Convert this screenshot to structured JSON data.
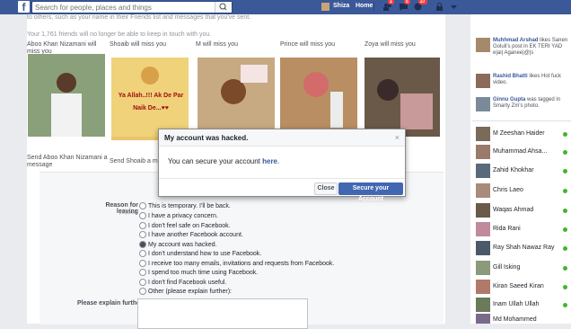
{
  "topbar": {
    "search_placeholder": "Search for people, places and things",
    "user_name": "Shiza",
    "home_label": "Home",
    "badges": {
      "friends": "1",
      "messages": "5",
      "notifications": "27"
    }
  },
  "header_text": "to others, such as your name in their Friends list and messages that you've sent.",
  "friends_note": "Your 1,761 friends will no longer be able to keep in touch with you.",
  "friends": [
    {
      "caption": "Aboo Khan Nizamani will miss you",
      "send": "Send Aboo Khan Nizamani a message",
      "img_color": "#6b7a5a"
    },
    {
      "caption": "Shoaib will miss you",
      "send": "Send Shoaib a message",
      "img_color": "#e0a94a",
      "overlay_text": "Ya Allah..!!!  Ak De Par Naik De...♥♥"
    },
    {
      "caption": "M will miss you",
      "send": "",
      "img_color": "#b88a5a"
    },
    {
      "caption": "Prince will miss you",
      "send": "",
      "img_color": "#c99a6a"
    },
    {
      "caption": "Zoya will miss you",
      "send": "",
      "img_color": "#5a4a3a"
    }
  ],
  "form": {
    "reason_label": "Reason for leaving",
    "required_label": "(required)",
    "options": [
      "This is temporary. I'll be back.",
      "I have a privacy concern.",
      "I don't feel safe on Facebook.",
      "I have another Facebook account.",
      "My account was hacked.",
      "I don't understand how to use Facebook.",
      "I receive too many emails, invitations and requests from Facebook.",
      "I spend too much time using Facebook.",
      "I don't find Facebook useful.",
      "Other (please explain further):"
    ],
    "explain_label": "Please explain further"
  },
  "dialog": {
    "title": "My account was hacked.",
    "message_prefix": "You can secure your account ",
    "message_link": "here",
    "message_suffix": ".",
    "close_label": "Close",
    "secure_label": "Secure your Account",
    "close_x": "×"
  },
  "ticker": [
    {
      "name": "Muhhmad Arshad",
      "text": " likes Sanen Goluli's post in EK TERI YAD e|ai| Aganee|@|s",
      "color": "#a58a6a"
    },
    {
      "name": "Rashid Bhatti",
      "text": " likes Hot fuck video.",
      "color": "#8a6a5a"
    },
    {
      "name": "Ginnu Gupta",
      "text": " was tagged in Smarty Zm's photo.",
      "color": "#7a8a9a"
    }
  ],
  "contacts": [
    {
      "name": "M Zeeshan Haider",
      "color": "#7a6a5a"
    },
    {
      "name": "Muhammad Ahsa...",
      "color": "#9a7a6a"
    },
    {
      "name": "Zahid Khokhar",
      "color": "#5a6a7a"
    },
    {
      "name": "Chris Laeo",
      "color": "#aa8a7a"
    },
    {
      "name": "Waqas Ahmad",
      "color": "#6a5a4a"
    },
    {
      "name": "Rida Rani",
      "color": "#c08a9a"
    },
    {
      "name": "Ray Shah Nawaz Ray",
      "color": "#4a5a6a"
    },
    {
      "name": "Gill Isking",
      "color": "#8a9a7a"
    },
    {
      "name": "Kiran Saeed Kiran",
      "color": "#b07a6a"
    },
    {
      "name": "Inam Ullah Ullah",
      "color": "#6a7a5a"
    },
    {
      "name": "Md Mohammed",
      "color": "#7a6a8a"
    }
  ],
  "colors": {
    "brand": "#3b5998",
    "button": "#4267b2",
    "link": "#365899",
    "online": "#42b72a"
  }
}
